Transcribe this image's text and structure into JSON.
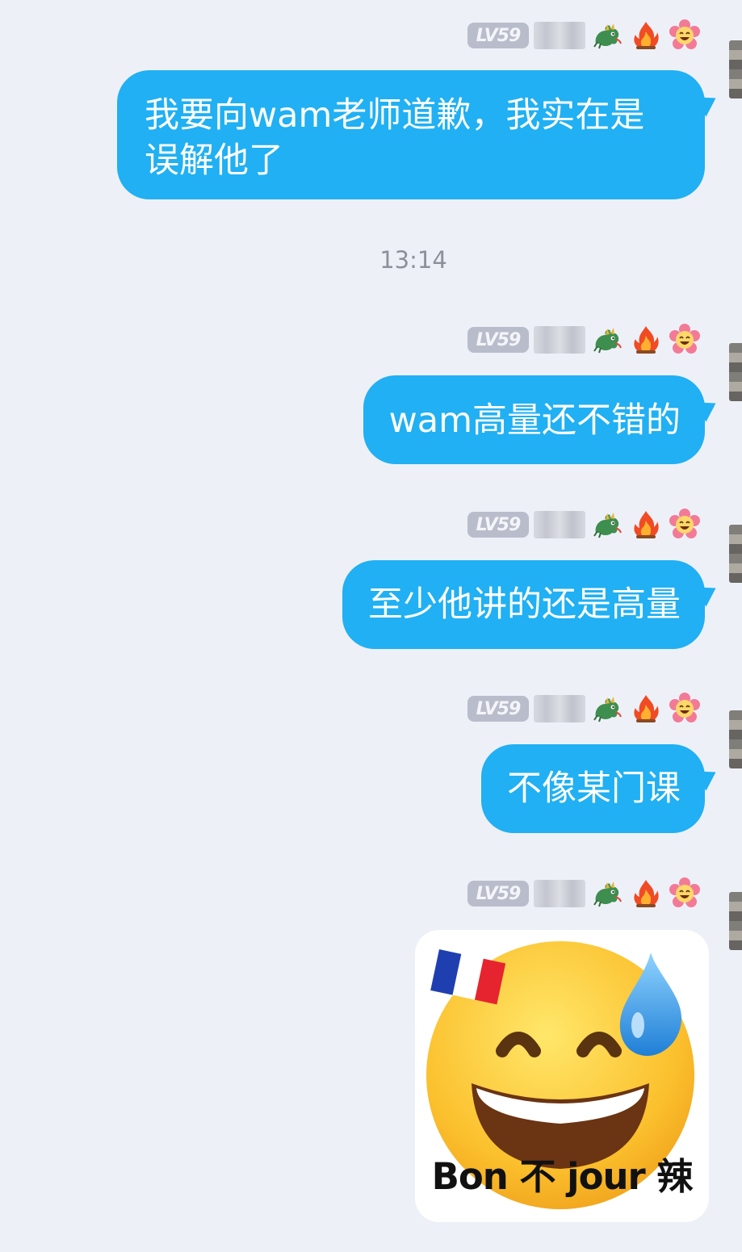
{
  "messages": [
    {
      "level": "LV59",
      "text": "我要向wam老师道歉，我实在是误解他了"
    },
    {
      "level": "LV59",
      "text": "wam高量还不错的"
    },
    {
      "level": "LV59",
      "text": "至少他讲的还是高量"
    },
    {
      "level": "LV59",
      "text": "不像某门课"
    },
    {
      "level": "LV59",
      "sticker_caption": "Bon 不 jour 辣"
    }
  ],
  "timestamp": "13:14",
  "colors": {
    "background": "#eef0f8",
    "bubble": "#20b0f3",
    "bubble_text": "#ffffff",
    "level_badge": "#b9bdcb",
    "timestamp_text": "#8d9099"
  },
  "icons": [
    "dragon-icon",
    "fire-icon",
    "smiling-flower-icon",
    "grinning-sweat-emoji-sticker",
    "french-flag-icon",
    "sweat-drop-icon"
  ]
}
